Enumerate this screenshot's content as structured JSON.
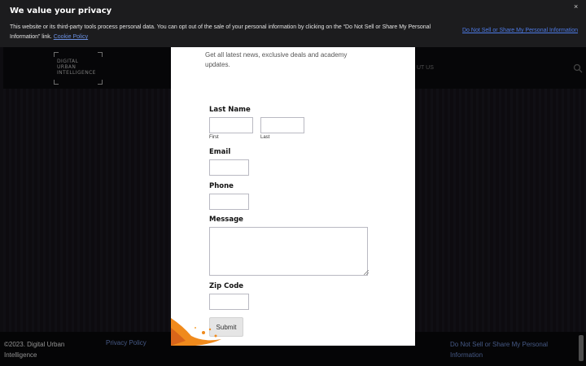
{
  "cookie_banner": {
    "title": "We value your privacy",
    "text": "This website or its third-party tools process personal data. You can opt out of the sale of your personal information by clicking on the “Do Not Sell or Share My Personal Information” link.",
    "policy_link": "Cookie Policy",
    "dns_link": "Do Not Sell or Share My Personal Information",
    "close": "×"
  },
  "header": {
    "logo_lines": [
      "DIGITAL",
      "URBAN",
      "INTELLIGENCE"
    ],
    "nav_partial": "UT US"
  },
  "modal": {
    "intro": "Get all latest news, exclusive deals and academy updates.",
    "last_name_label": "Last Name",
    "first_sub": "First",
    "last_sub": "Last",
    "email_label": "Email",
    "phone_label": "Phone",
    "message_label": "Message",
    "zip_label": "Zip Code",
    "submit_label": "Submit"
  },
  "footer": {
    "copyright": "©2023. Digital Urban Intelligence",
    "privacy": "Privacy Policy",
    "dns": "Do Not Sell or Share My Personal Information"
  },
  "colors": {
    "banner_bg": "#1c1c1e",
    "link": "#4e7be6",
    "splash": "#f08a1c"
  }
}
